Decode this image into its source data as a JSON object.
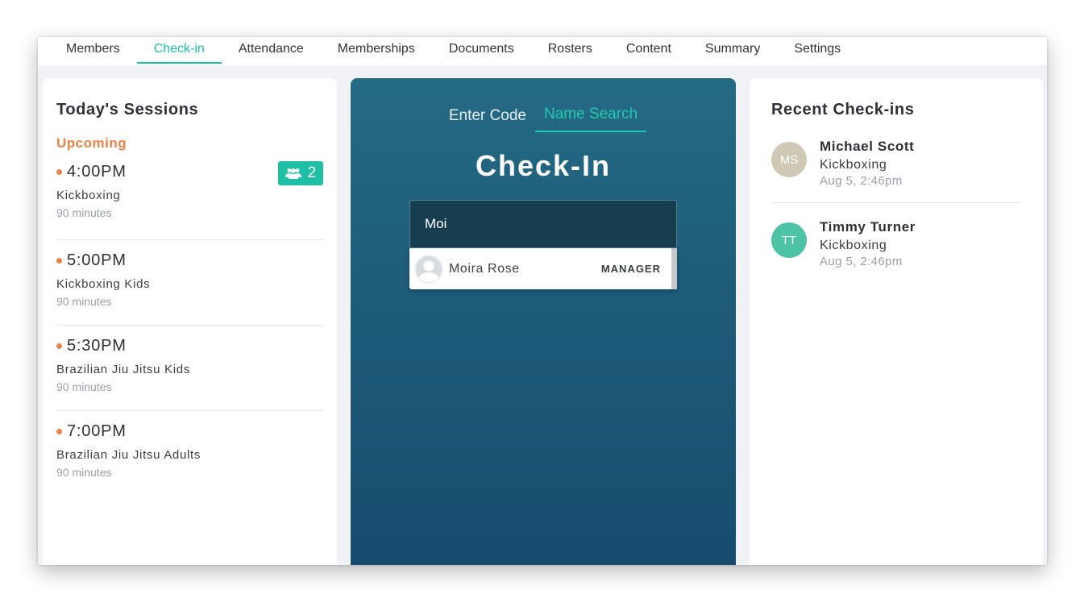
{
  "nav": {
    "tabs": [
      {
        "label": "Members"
      },
      {
        "label": "Check-in"
      },
      {
        "label": "Attendance"
      },
      {
        "label": "Memberships"
      },
      {
        "label": "Documents"
      },
      {
        "label": "Rosters"
      },
      {
        "label": "Content"
      },
      {
        "label": "Summary"
      },
      {
        "label": "Settings"
      }
    ],
    "active": "Check-in"
  },
  "sessions": {
    "title": "Today's Sessions",
    "group_label": "Upcoming",
    "items": [
      {
        "time": "4:00PM",
        "name": "Kickboxing",
        "duration": "90 minutes",
        "attendees": "2"
      },
      {
        "time": "5:00PM",
        "name": "Kickboxing Kids",
        "duration": "90 minutes"
      },
      {
        "time": "5:30PM",
        "name": "Brazilian Jiu Jitsu Kids",
        "duration": "90 minutes"
      },
      {
        "time": "7:00PM",
        "name": "Brazilian Jiu Jitsu Adults",
        "duration": "90 minutes"
      }
    ]
  },
  "checkin": {
    "modes": [
      {
        "label": "Enter Code"
      },
      {
        "label": "Name Search"
      }
    ],
    "active_mode": "Name Search",
    "title": "Check-In",
    "search_value": "Moi",
    "results": [
      {
        "name": "Moira Rose",
        "role": "MANAGER"
      }
    ]
  },
  "recent": {
    "title": "Recent Check-ins",
    "items": [
      {
        "initials": "MS",
        "name": "Michael Scott",
        "class": "Kickboxing",
        "time": "Aug 5, 2:46pm",
        "avatar_color": "#cfc8b4"
      },
      {
        "initials": "TT",
        "name": "Timmy Turner",
        "class": "Kickboxing",
        "time": "Aug 5, 2:46pm",
        "avatar_color": "#4cc3a5"
      }
    ]
  },
  "colors": {
    "accent": "#1fbfa6",
    "upcoming": "#e8834a",
    "panel_dark": "#1d5b79"
  }
}
